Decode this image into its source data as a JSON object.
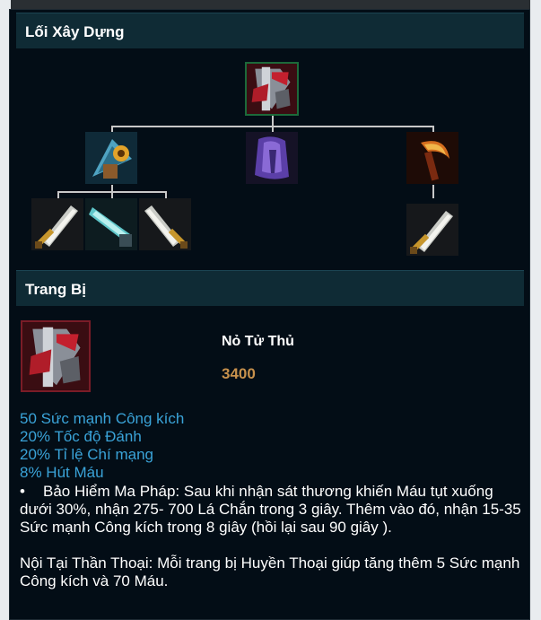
{
  "build_header": "Lối Xây Dựng",
  "equipment_header": "Trang Bị",
  "item": {
    "name": "Nỏ Tử Thủ",
    "cost": "3400",
    "stats": [
      "50 Sức mạnh Công kích",
      "20% Tốc độ Đánh",
      "20% Tỉ lệ Chí mạng",
      "8% Hút Máu"
    ],
    "passive": "Bảo Hiểm Ma Pháp: Sau khi nhận sát thương khiến Máu tụt xuống dưới 30%, nhận 275- 700 Lá Chắn trong 3 giây. Thêm vào đó, nhận 15-35 Sức mạnh Công kích trong 8 giây (hồi lại sau 90 giây ).",
    "mythic_passive": "Nội Tại Thần Thoại: Mỗi trang bị Huyền Thoại giúp tăng thêm 5 Sức mạnh Công kích và 70 Máu."
  },
  "icons": {
    "root": "immortal-shieldbow-icon",
    "component_left": "stridebreaker-bow-icon",
    "component_middle": "cloak-icon",
    "component_right": "sickle-icon",
    "long_sword": "long-sword-icon",
    "serrated_dirk": "serrated-dirk-icon"
  },
  "colors": {
    "panel_bg": "#030d16",
    "header_bg": "#0f2b35",
    "stat_blue": "#3aa3d8",
    "cost_gold": "#c8914c"
  }
}
